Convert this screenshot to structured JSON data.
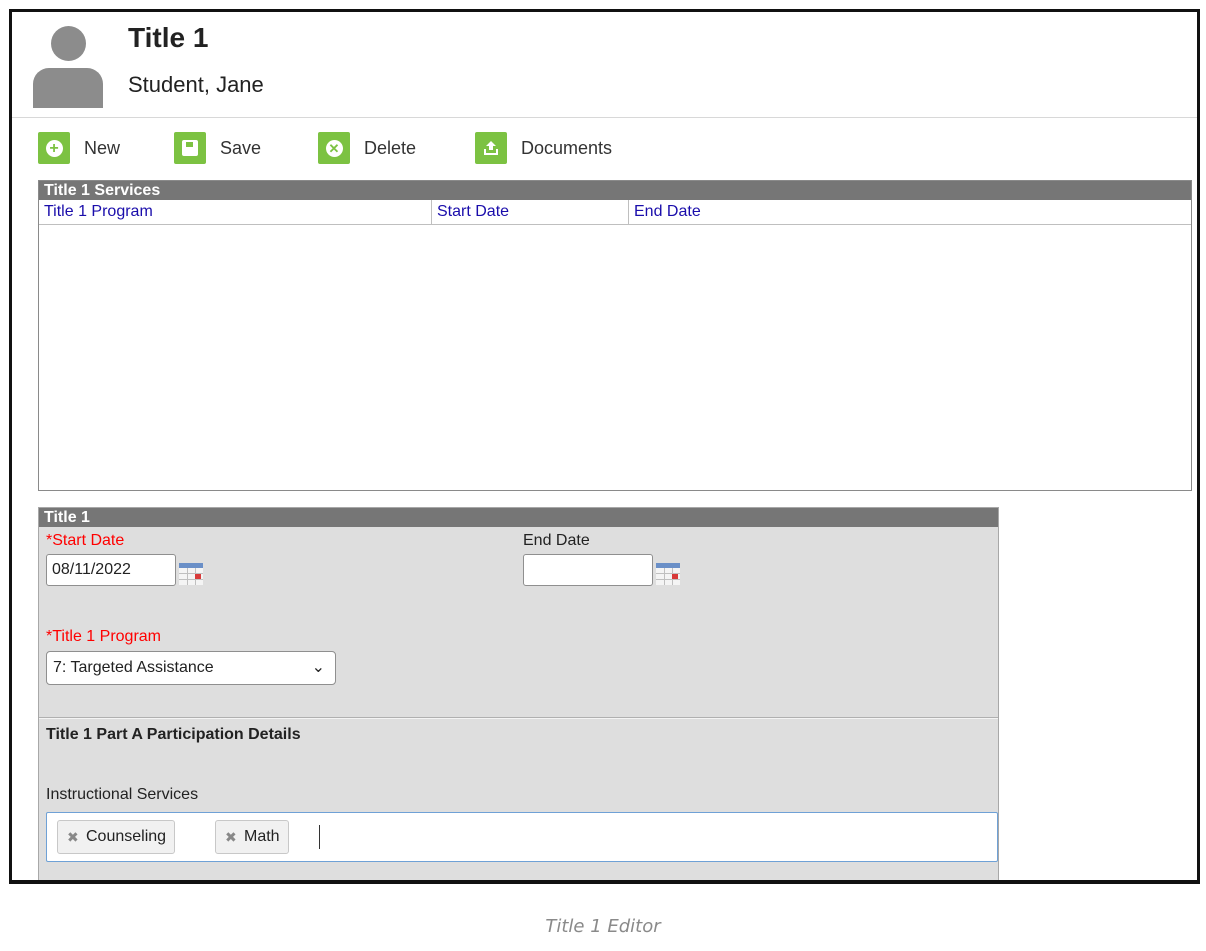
{
  "header": {
    "title": "Title 1",
    "student_name": "Student, Jane"
  },
  "toolbar": {
    "new_label": "New",
    "save_label": "Save",
    "delete_label": "Delete",
    "documents_label": "Documents",
    "accent_color": "#7cc242"
  },
  "services": {
    "section_title": "Title 1 Services",
    "columns": [
      "Title 1 Program",
      "Start Date",
      "End Date"
    ],
    "rows": []
  },
  "editor": {
    "section_title": "Title 1",
    "start_date_label": "*Start Date",
    "start_date_value": "08/11/2022",
    "end_date_label": "End Date",
    "end_date_value": "",
    "program_label": "*Title 1 Program",
    "program_value": "7: Targeted Assistance",
    "part_a_title": "Title 1 Part A Participation Details",
    "instructional_label": "Instructional Services",
    "instructional_tags": [
      "Counseling",
      "Math"
    ]
  },
  "caption": "Title 1 Editor"
}
